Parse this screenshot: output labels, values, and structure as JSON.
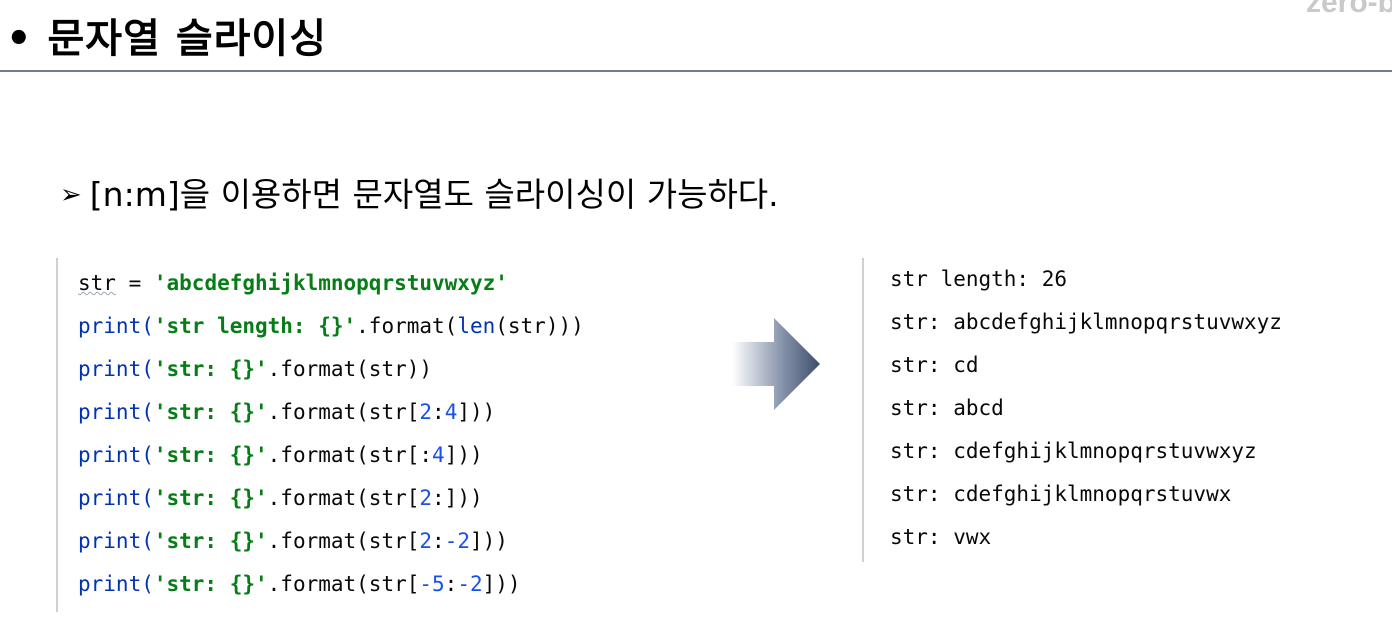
{
  "slide": {
    "title": "• 문자열 슬라이싱",
    "watermark": "zero-b",
    "bullet_marker": "➢",
    "bullet_text": "[n:m]을 이용하면 문자열도 슬라이싱이 가능하다."
  },
  "code": {
    "line1": {
      "a": "str",
      "b": " = ",
      "c": "'abcdefghijklmnopqrstuvwxyz'"
    },
    "line2": {
      "a": "print(",
      "b": "'str length: {}'",
      "c": ".format(",
      "d": "len",
      "e": "(str)))"
    },
    "line3": {
      "a": "print(",
      "b": "'str: {}'",
      "c": ".format(str))"
    },
    "line4": {
      "a": "print(",
      "b": "'str: {}'",
      "c": ".format(str[",
      "d": "2",
      "e": ":",
      "f": "4",
      "g": "]))"
    },
    "line5": {
      "a": "print(",
      "b": "'str: {}'",
      "c": ".format(str[:",
      "d": "4",
      "e": "]))"
    },
    "line6": {
      "a": "print(",
      "b": "'str: {}'",
      "c": ".format(str[",
      "d": "2",
      "e": ":]))"
    },
    "line7": {
      "a": "print(",
      "b": "'str: {}'",
      "c": ".format(str[",
      "d": "2",
      "e": ":",
      "f": "-2",
      "g": "]))"
    },
    "line8": {
      "a": "print(",
      "b": "'str: {}'",
      "c": ".format(str[",
      "d": "-5",
      "e": ":",
      "f": "-2",
      "g": "]))"
    }
  },
  "output": [
    "str length: 26",
    "str: abcdefghijklmnopqrstuvwxyz",
    "str: cd",
    "str: abcd",
    "str: cdefghijklmnopqrstuvwxyz",
    "str: cdefghijklmnopqrstuvwx",
    "str: vwx"
  ],
  "colors": {
    "keyword": "#0033b3",
    "string": "#067d17",
    "number": "#1750eb",
    "arrow_dark": "#3d4d6b",
    "divider": "#6b7f96"
  },
  "icons": {
    "arrow": "right-arrow-icon"
  }
}
